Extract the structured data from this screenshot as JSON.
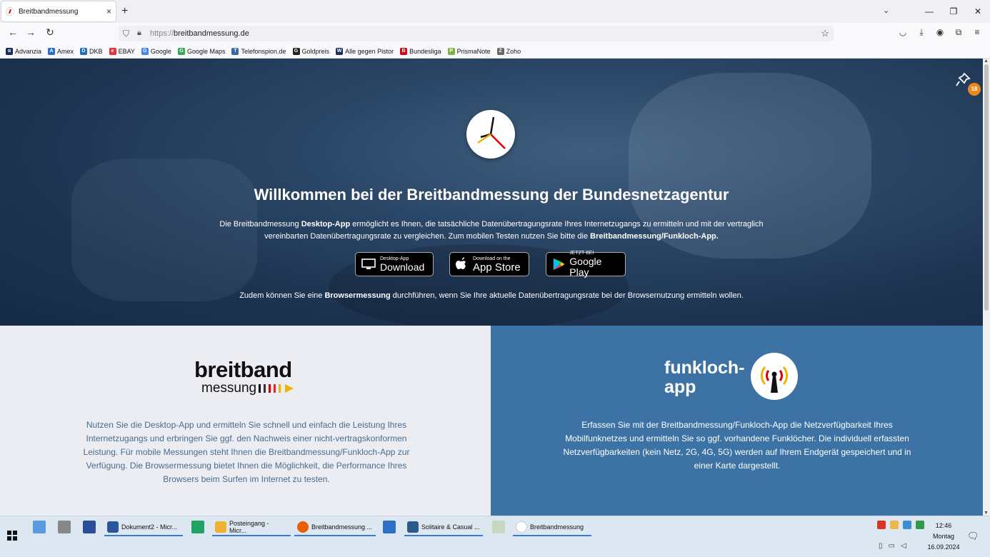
{
  "browser": {
    "tab_title": "Breitbandmessung",
    "tab_close": "×",
    "new_tab": "+",
    "url_protocol": "https://",
    "url_host": "breitbandmessung.de"
  },
  "bookmarks": [
    {
      "label": "Advanzia",
      "color": "#1a2a5a",
      "glyph": "α"
    },
    {
      "label": "Amex",
      "color": "#2a6ec8",
      "glyph": "A"
    },
    {
      "label": "DKB",
      "color": "#1d6fb8",
      "glyph": "D"
    },
    {
      "label": "EBAY",
      "color": "#e53238",
      "glyph": "e"
    },
    {
      "label": "Google",
      "color": "#4285f4",
      "glyph": "G"
    },
    {
      "label": "Google Maps",
      "color": "#34a853",
      "glyph": "G"
    },
    {
      "label": "Telefonspion.de",
      "color": "#3c6aa0",
      "glyph": "T"
    },
    {
      "label": "Goldpreis",
      "color": "#222222",
      "glyph": "G"
    },
    {
      "label": "Alle gegen Pistor",
      "color": "#1b2d5b",
      "glyph": "W"
    },
    {
      "label": "Bundesliga",
      "color": "#d20515",
      "glyph": "B"
    },
    {
      "label": "PrismaNote",
      "color": "#7cb342",
      "glyph": "P"
    },
    {
      "label": "Zoho",
      "color": "#666666",
      "glyph": "Z"
    }
  ],
  "hero": {
    "title": "Willkommen bei der Breitbandmessung der Bundesnetzagentur",
    "intro_1": "Die Breitbandmessung ",
    "intro_2": "Desktop-App",
    "intro_3": " ermöglicht es Ihnen, die tatsächliche Datenübertragungsrate Ihres Internetzugangs zu ermitteln und mit der vertraglich vereinbarten Datenübertragungsrate zu vergleichen. Zum mobilen Testen nutzen Sie bitte die ",
    "intro_4": "Breitbandmessung/Funkloch-App.",
    "browser_1": "Zudem können Sie eine ",
    "browser_2": "Browsermessung",
    "browser_3": " durchführen, wenn Sie Ihre aktuelle Datenübertragungsrate bei der Browsernutzung ermitteln wollen.",
    "notification_count": "18"
  },
  "stores": {
    "desktop_small": "Desktop-App",
    "desktop_big": "Download",
    "apple_small": "Download on the",
    "apple_big": "App Store",
    "google_small": "JETZT BEI",
    "google_big": "Google Play"
  },
  "left_panel": {
    "brand_big": "breitband",
    "brand_small": "messung",
    "text": "Nutzen Sie die Desktop-App und ermitteln Sie schnell und einfach die Leistung Ihres Internetzugangs und erbringen Sie ggf. den Nachweis einer nicht-vertragskonformen Leistung. Für mobile Messungen steht Ihnen die Breitbandmessung/Funkloch-App zur Verfügung. Die Browsermessung bietet Ihnen die Möglichkeit, die Performance Ihres Browsers beim Surfen im Internet zu testen."
  },
  "right_panel": {
    "title_1": "funkloch-",
    "title_2": "app",
    "text": "Erfassen Sie mit der Breitbandmessung/Funkloch-App die Netzverfügbarkeit Ihres Mobilfunknetzes und ermitteln Sie so ggf. vorhandene Funklöcher. Die individuell erfassten Netzverfügbarkeiten (kein Netz, 2G, 4G, 5G) werden auf Ihrem Endgerät gespeichert und in einer Karte dargestellt."
  },
  "taskbar": {
    "apps": [
      {
        "label": "Dokument2 - Micr...",
        "color": "#2b579a"
      },
      {
        "label": "Posteingang - Micr...",
        "color": "#f0b030"
      },
      {
        "label": "Breitbandmessung ...",
        "color": "#e66000"
      },
      {
        "label": "Solitaire & Casual ...",
        "color": "#2d5a88"
      },
      {
        "label": "Breitbandmessung",
        "color": "#ffffff"
      }
    ],
    "time": "12:46",
    "weekday": "Montag",
    "date": "16.09.2024"
  }
}
